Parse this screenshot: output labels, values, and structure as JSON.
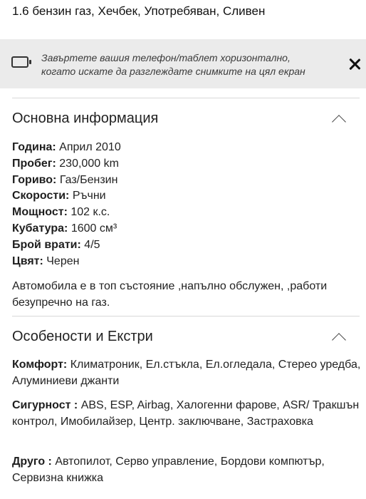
{
  "header": {
    "subtitle": "1.6 бензин газ, Хечбек, Употребяван, Сливен"
  },
  "banner": {
    "icon": "device-rotate-icon",
    "message": "Завъртете вашия телефон/таблет хоризонтално, когато искате да разглеждате снимките на цял екран",
    "close_icon": "close-icon"
  },
  "basic_info": {
    "title": "Основна информация",
    "toggle_icon": "chevron-up-icon",
    "specs": [
      {
        "label": "Година:",
        "value": "Април 2010"
      },
      {
        "label": "Пробег:",
        "value": "230,000 km"
      },
      {
        "label": "Гориво:",
        "value": "Газ/Бензин"
      },
      {
        "label": "Скорости:",
        "value": "Ръчни"
      },
      {
        "label": "Мощност:",
        "value": "102 к.с."
      },
      {
        "label": "Кубатура:",
        "value": "1600 см³"
      },
      {
        "label": "Брой врати:",
        "value": "4/5"
      },
      {
        "label": "Цвят:",
        "value": "Черен"
      }
    ],
    "description": "Автомобила е в топ състояние ,напълно обслужен, ,работи безупречно на газ."
  },
  "features": {
    "title": "Особености и Екстри",
    "toggle_icon": "chevron-up-icon",
    "groups": [
      {
        "label": "Комфорт:",
        "value": "Климатроник, Ел.стъкла, Ел.огледала, Стерео уредба, Алуминиеви джанти"
      },
      {
        "label": "Сигурност :",
        "value": "ABS, ESP, Airbag, Халогенни фарове, ASR/ Тракшън контрол, Имобилайзер, Центр. заключване, Застраховка"
      },
      {
        "label": "Друго :",
        "value": "Автопилот, Серво управление, Бордови компютър, Сервизна книжка"
      }
    ]
  }
}
